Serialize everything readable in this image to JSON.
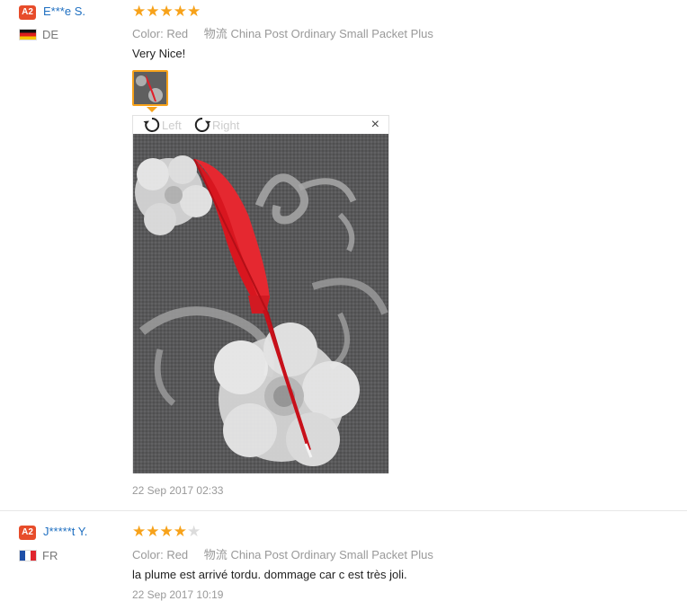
{
  "reviews": [
    {
      "badge": "A2",
      "user": "E***e S.",
      "country": "DE",
      "stars": [
        "★",
        "★",
        "★",
        "★",
        "★"
      ],
      "rating": 5,
      "color_label": "Color:",
      "color_value": "Red",
      "shipping_label": "物流",
      "shipping_value": "China Post Ordinary Small Packet Plus",
      "text": "Very Nice!",
      "date": "22 Sep 2017 02:33"
    },
    {
      "badge": "A2",
      "user": "J*****t Y.",
      "country": "FR",
      "stars": [
        "★",
        "★",
        "★",
        "★",
        "★"
      ],
      "rating": 4,
      "color_label": "Color:",
      "color_value": "Red",
      "shipping_label": "物流",
      "shipping_value": "China Post Ordinary Small Packet Plus",
      "text": "la plume est arrivé tordu. dommage car c est très joli.",
      "date": "22 Sep 2017 10:19"
    }
  ],
  "viewer": {
    "rotate_left": "Left",
    "rotate_right": "Right",
    "close": "×"
  },
  "colors": {
    "accent": "#f7a21a",
    "username": "#1e6fc1",
    "badge": "#e74c2a",
    "feather": "#e0202a"
  }
}
